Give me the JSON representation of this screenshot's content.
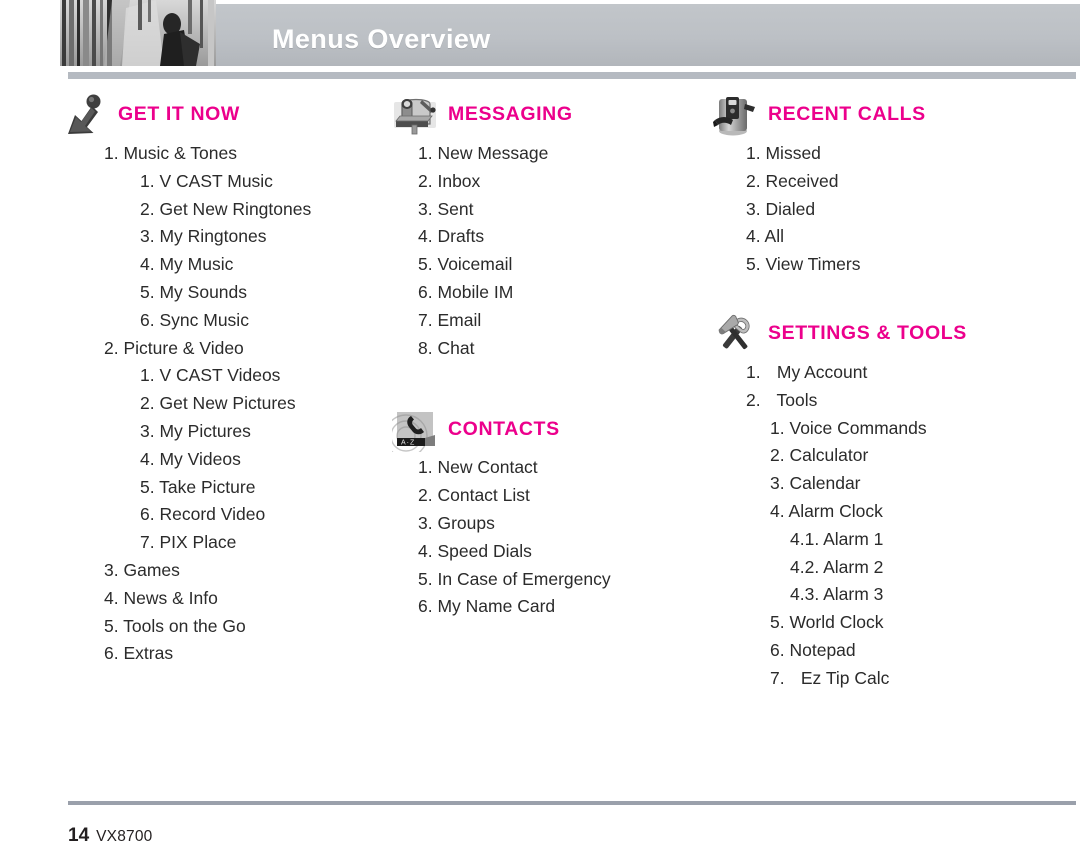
{
  "header": {
    "title": "Menus Overview",
    "photo_alt": "header-photo-strip"
  },
  "footer": {
    "page_number": "14",
    "model": "VX8700"
  },
  "colors": {
    "accent": "#ec008c",
    "header_band": "#bcc0c5",
    "rule": "#b5bac1",
    "text": "#2b2b2b"
  },
  "columns": [
    {
      "sections": [
        {
          "title": "GET IT NOW",
          "icon": "arrow-person-icon",
          "items": [
            {
              "level": 1,
              "num": "1.",
              "label": "Music & Tones"
            },
            {
              "level": 2,
              "num": "1.",
              "label": "V CAST Music"
            },
            {
              "level": 2,
              "num": "2.",
              "label": "Get New Ringtones"
            },
            {
              "level": 2,
              "num": "3.",
              "label": "My Ringtones"
            },
            {
              "level": 2,
              "num": "4.",
              "label": "My Music"
            },
            {
              "level": 2,
              "num": "5.",
              "label": "My Sounds"
            },
            {
              "level": 2,
              "num": "6.",
              "label": "Sync Music"
            },
            {
              "level": 1,
              "num": "2.",
              "label": "Picture & Video"
            },
            {
              "level": 2,
              "num": "1.",
              "label": "V CAST Videos"
            },
            {
              "level": 2,
              "num": "2.",
              "label": "Get New Pictures"
            },
            {
              "level": 2,
              "num": "3.",
              "label": "My Pictures"
            },
            {
              "level": 2,
              "num": "4.",
              "label": "My Videos"
            },
            {
              "level": 2,
              "num": "5.",
              "label": "Take Picture"
            },
            {
              "level": 2,
              "num": "6.",
              "label": "Record Video"
            },
            {
              "level": 2,
              "num": "7.",
              "label": "PIX Place"
            },
            {
              "level": 1,
              "num": "3.",
              "label": "Games"
            },
            {
              "level": 1,
              "num": "4.",
              "label": "News & Info"
            },
            {
              "level": 1,
              "num": "5.",
              "label": "Tools on the Go"
            },
            {
              "level": 1,
              "num": "6.",
              "label": "Extras"
            }
          ]
        }
      ]
    },
    {
      "sections": [
        {
          "title": "MESSAGING",
          "icon": "mailbox-icon",
          "items": [
            {
              "level": 1,
              "num": "1.",
              "label": "New Message"
            },
            {
              "level": 1,
              "num": "2.",
              "label": "Inbox"
            },
            {
              "level": 1,
              "num": "3.",
              "label": "Sent"
            },
            {
              "level": 1,
              "num": "4.",
              "label": "Drafts"
            },
            {
              "level": 1,
              "num": "5.",
              "label": "Voicemail"
            },
            {
              "level": 1,
              "num": "6.",
              "label": "Mobile IM"
            },
            {
              "level": 1,
              "num": "7.",
              "label": "Email"
            },
            {
              "level": 1,
              "num": "8.",
              "label": "Chat"
            }
          ]
        },
        {
          "title": "CONTACTS",
          "icon": "phone-handset-az-icon",
          "items": [
            {
              "level": 1,
              "num": "1.",
              "label": "New Contact"
            },
            {
              "level": 1,
              "num": "2.",
              "label": "Contact List"
            },
            {
              "level": 1,
              "num": "3.",
              "label": "Groups"
            },
            {
              "level": 1,
              "num": "4.",
              "label": "Speed Dials"
            },
            {
              "level": 1,
              "num": "5.",
              "label": "In Case of Emergency"
            },
            {
              "level": 1,
              "num": "6.",
              "label": "My Name Card"
            }
          ]
        }
      ]
    },
    {
      "sections": [
        {
          "title": "RECENT CALLS",
          "icon": "answering-machine-icon",
          "items": [
            {
              "level": 1,
              "num": "1.",
              "label": "Missed"
            },
            {
              "level": 1,
              "num": "2.",
              "label": "Received"
            },
            {
              "level": 1,
              "num": "3.",
              "label": "Dialed"
            },
            {
              "level": 1,
              "num": "4.",
              "label": "All"
            },
            {
              "level": 1,
              "num": "5.",
              "label": "View Timers"
            }
          ]
        },
        {
          "title": "SETTINGS & TOOLS",
          "icon": "wrench-hammer-icon",
          "items": [
            {
              "level": 1,
              "num": "1.",
              "label": "My Account",
              "wide": true
            },
            {
              "level": 1,
              "num": "2.",
              "label": "Tools",
              "wide": true
            },
            {
              "level": 2,
              "num": "1.",
              "label": "Voice Commands"
            },
            {
              "level": 2,
              "num": "2.",
              "label": "Calculator"
            },
            {
              "level": 2,
              "num": "3.",
              "label": "Calendar"
            },
            {
              "level": 2,
              "num": "4.",
              "label": "Alarm Clock"
            },
            {
              "level": 3,
              "num": "4.1.",
              "label": "Alarm 1"
            },
            {
              "level": 3,
              "num": "4.2.",
              "label": "Alarm 2"
            },
            {
              "level": 3,
              "num": "4.3.",
              "label": "Alarm 3"
            },
            {
              "level": 2,
              "num": "5.",
              "label": "World Clock"
            },
            {
              "level": 2,
              "num": "6.",
              "label": "Notepad"
            },
            {
              "level": 2,
              "num": "7.",
              "label": "Ez Tip Calc"
            }
          ]
        }
      ]
    }
  ]
}
